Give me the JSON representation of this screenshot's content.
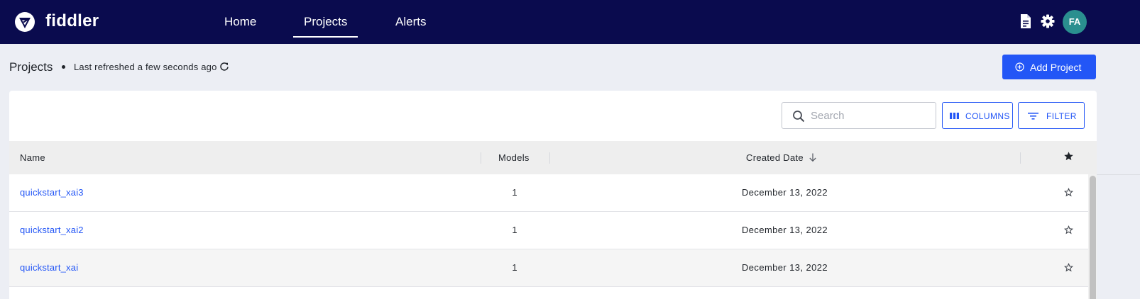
{
  "navbar": {
    "brand": "fiddler",
    "items": [
      {
        "label": "Home",
        "active": false
      },
      {
        "label": "Projects",
        "active": true
      },
      {
        "label": "Alerts",
        "active": false
      }
    ],
    "icons": [
      "document-icon",
      "gear-icon"
    ],
    "avatar_initials": "FA"
  },
  "subheader": {
    "title": "Projects",
    "refresh_status": "Last refreshed a few seconds ago",
    "add_button_label": "Add Project"
  },
  "toolbar": {
    "search_placeholder": "Search",
    "search_value": "",
    "columns_label": "COLUMNS",
    "filter_label": "FILTER"
  },
  "table": {
    "columns": [
      "Name",
      "Models",
      "Created Date"
    ],
    "sort": {
      "column": "Created Date",
      "direction": "descending"
    },
    "rows": [
      {
        "name": "quickstart_xai3",
        "models": "1",
        "created": "December 13, 2022",
        "favorite": false
      },
      {
        "name": "quickstart_xai2",
        "models": "1",
        "created": "December 13, 2022",
        "favorite": false
      },
      {
        "name": "quickstart_xai",
        "models": "1",
        "created": "December 13, 2022",
        "favorite": false
      }
    ]
  },
  "colors": {
    "navbar": "#0a0b4e",
    "accent": "#2356f6",
    "avatar": "#2a8f8f"
  }
}
